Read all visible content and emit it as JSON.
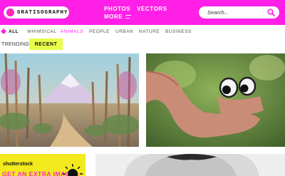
{
  "header": {
    "logo_text": "GRATISOGRAPHY",
    "nav": {
      "photos": "PHOTOS",
      "vectors": "VECTORS",
      "more": "MORE"
    },
    "search_placeholder": "Search...",
    "colors": {
      "brand": "#ff1fe6",
      "logo_mark": "#ff3d5f"
    }
  },
  "categories": {
    "items": [
      "ALL",
      "WHIMSICAL",
      "ANIMALS",
      "PEOPLE",
      "URBAN",
      "NATURE",
      "BUSINESS"
    ],
    "active": "ALL",
    "highlighted": "ANIMALS"
  },
  "tabs": {
    "trending": "TRENDING",
    "recent": "RECENT",
    "selected": "RECENT",
    "accent": "#e8ff4a"
  },
  "ad": {
    "brand": "shutterstock",
    "text": "GET AN EXTRA IMAGES"
  },
  "icons": [
    "search-icon",
    "menu-icon",
    "filter-icon",
    "sun-icon"
  ]
}
